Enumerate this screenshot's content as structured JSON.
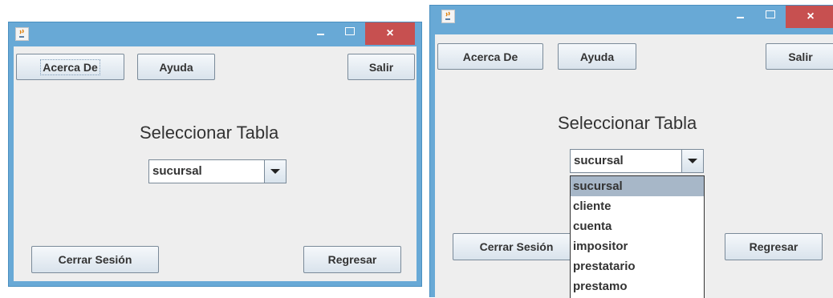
{
  "window_left": {
    "buttons": {
      "about": "Acerca De",
      "help": "Ayuda",
      "exit": "Salir",
      "logout": "Cerrar Sesión",
      "back": "Regresar"
    },
    "heading": "Seleccionar Tabla",
    "combo": {
      "selected": "sucursal"
    },
    "title_controls": {
      "close": "×"
    }
  },
  "window_right": {
    "buttons": {
      "about": "Acerca De",
      "help": "Ayuda",
      "exit": "Salir",
      "logout": "Cerrar Sesión",
      "back": "Regresar"
    },
    "heading": "Seleccionar Tabla",
    "combo": {
      "selected": "sucursal",
      "options": [
        "sucursal",
        "cliente",
        "cuenta",
        "impositor",
        "prestatario",
        "prestamo"
      ],
      "highlighted": "sucursal"
    },
    "title_controls": {
      "close": "×"
    }
  },
  "icons": {
    "app": "java-coffee-cup-icon",
    "minimize": "minimize-icon",
    "maximize": "maximize-icon",
    "close": "close-icon",
    "dropdown": "chevron-down-icon"
  },
  "colors": {
    "title_bar": "#68a9d6",
    "close_button": "#c75050",
    "client_bg": "#eeeeee",
    "selection": "#a7b7c8"
  }
}
